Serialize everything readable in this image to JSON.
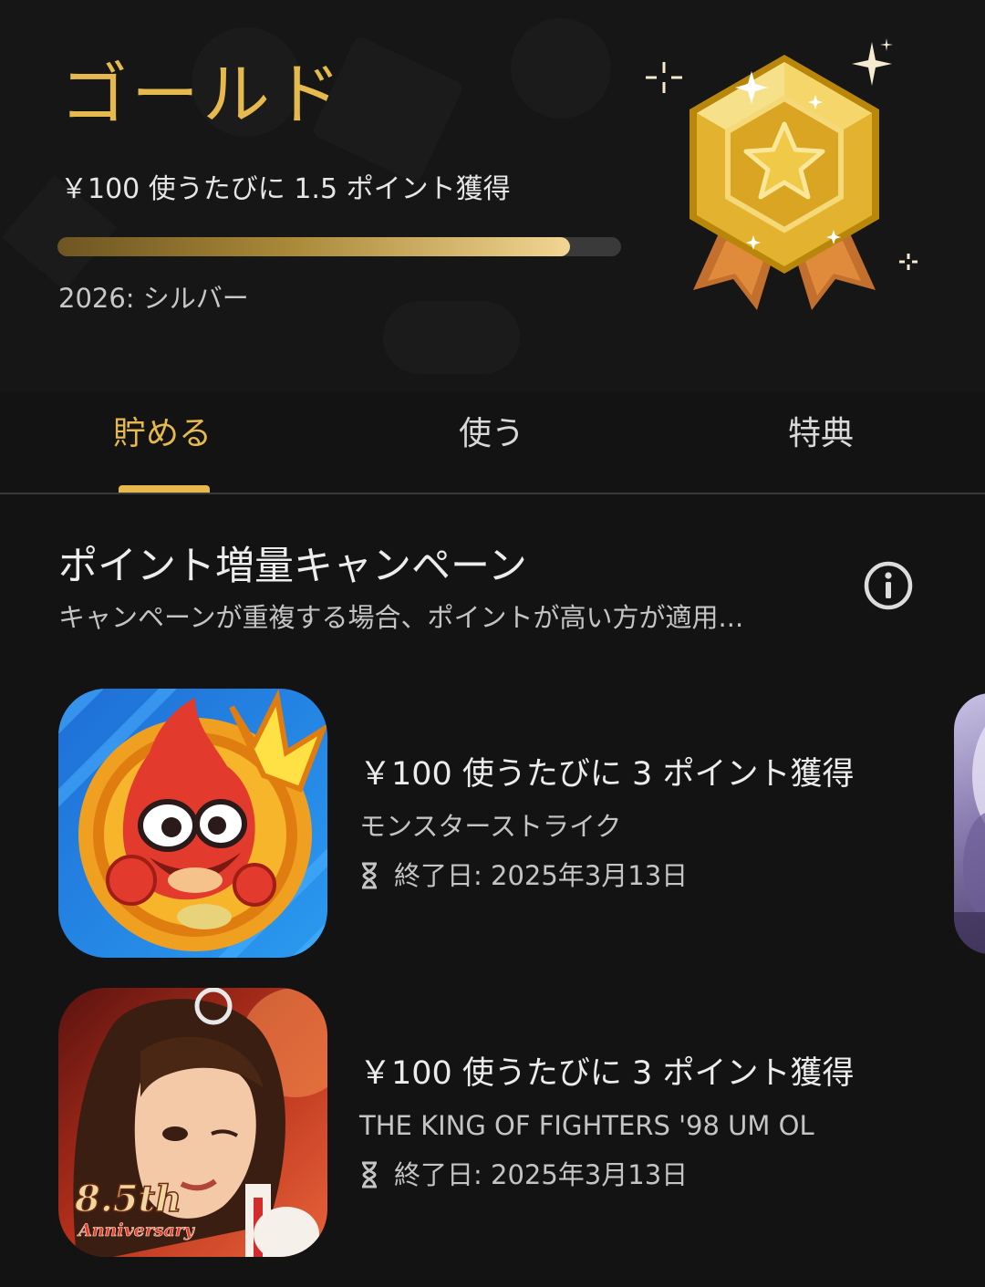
{
  "header": {
    "tier_title": "ゴールド",
    "earn_rate": "￥100 使うたびに 1.5 ポイント獲得",
    "progress_fraction": 0.91,
    "next_tier": "2026: シルバー",
    "medal_icon": "gold-star-medal-icon",
    "accent_color": "#e6b94c"
  },
  "tabs": [
    {
      "label": "貯める",
      "active": true
    },
    {
      "label": "使う",
      "active": false
    },
    {
      "label": "特典",
      "active": false
    }
  ],
  "campaign": {
    "title": "ポイント増量キャンペーン",
    "subtitle": "キャンペーンが重複する場合、ポイントが高い方が適用...",
    "info_icon": "info-icon"
  },
  "apps": [
    {
      "offer": "￥100 使うたびに 3 ポイント獲得",
      "name": "モンスターストライク",
      "end_date": "終了日: 2025年3月13日",
      "icon": "monster-strike-app-icon"
    },
    {
      "offer": "￥100 使うたびに 3 ポイント獲得",
      "name": "THE KING OF FIGHTERS '98 UM OL",
      "end_date": "終了日: 2025年3月13日",
      "icon": "kof98-app-icon",
      "icon_badge_line1": "8.5th",
      "icon_badge_line2": "Anniversary"
    }
  ]
}
